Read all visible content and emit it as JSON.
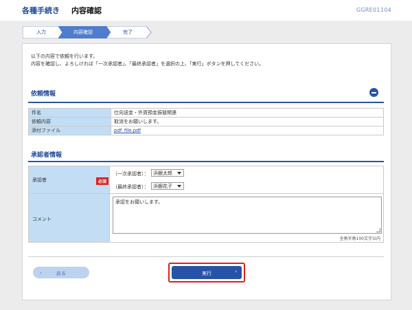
{
  "header": {
    "title": "各種手続き",
    "subtitle": "内容確認",
    "screen_id": "GGRE01104"
  },
  "steps": [
    {
      "label": "入力",
      "state": "done"
    },
    {
      "label": "内容確認",
      "state": "active"
    },
    {
      "label": "完了",
      "state": "todo"
    }
  ],
  "intro": {
    "line1": "以下の内容で依頼を行います。",
    "line2": "内容を確認し、よろしければ「一次承認者」、「最終承認者」を選択の上、「実行」ボタンを押してください。"
  },
  "request_info": {
    "title": "依頼情報",
    "rows": [
      {
        "label": "件名",
        "value": "仕向送金・外貨預金振替関連"
      },
      {
        "label": "依頼内容",
        "value": "取消をお願いします。"
      },
      {
        "label": "添付ファイル",
        "value": "pdf_file.pdf"
      }
    ]
  },
  "approver_info": {
    "title": "承認者情報",
    "approver_label": "承認者",
    "required_badge": "必須",
    "first_label": "（一次承認者）：",
    "first_value": "浜銀太郎",
    "final_label": "（最終承認者）：",
    "final_value": "浜銀花子",
    "comment_label": "コメント",
    "comment_value": "承認をお願いします。",
    "comment_hint": "全角半角100文字以内"
  },
  "buttons": {
    "back": "戻る",
    "execute": "実行"
  },
  "colors": {
    "primary": "#2653a6",
    "label_bg": "#c3def4",
    "highlight": "#e21c1c",
    "required": "#dd2222"
  }
}
